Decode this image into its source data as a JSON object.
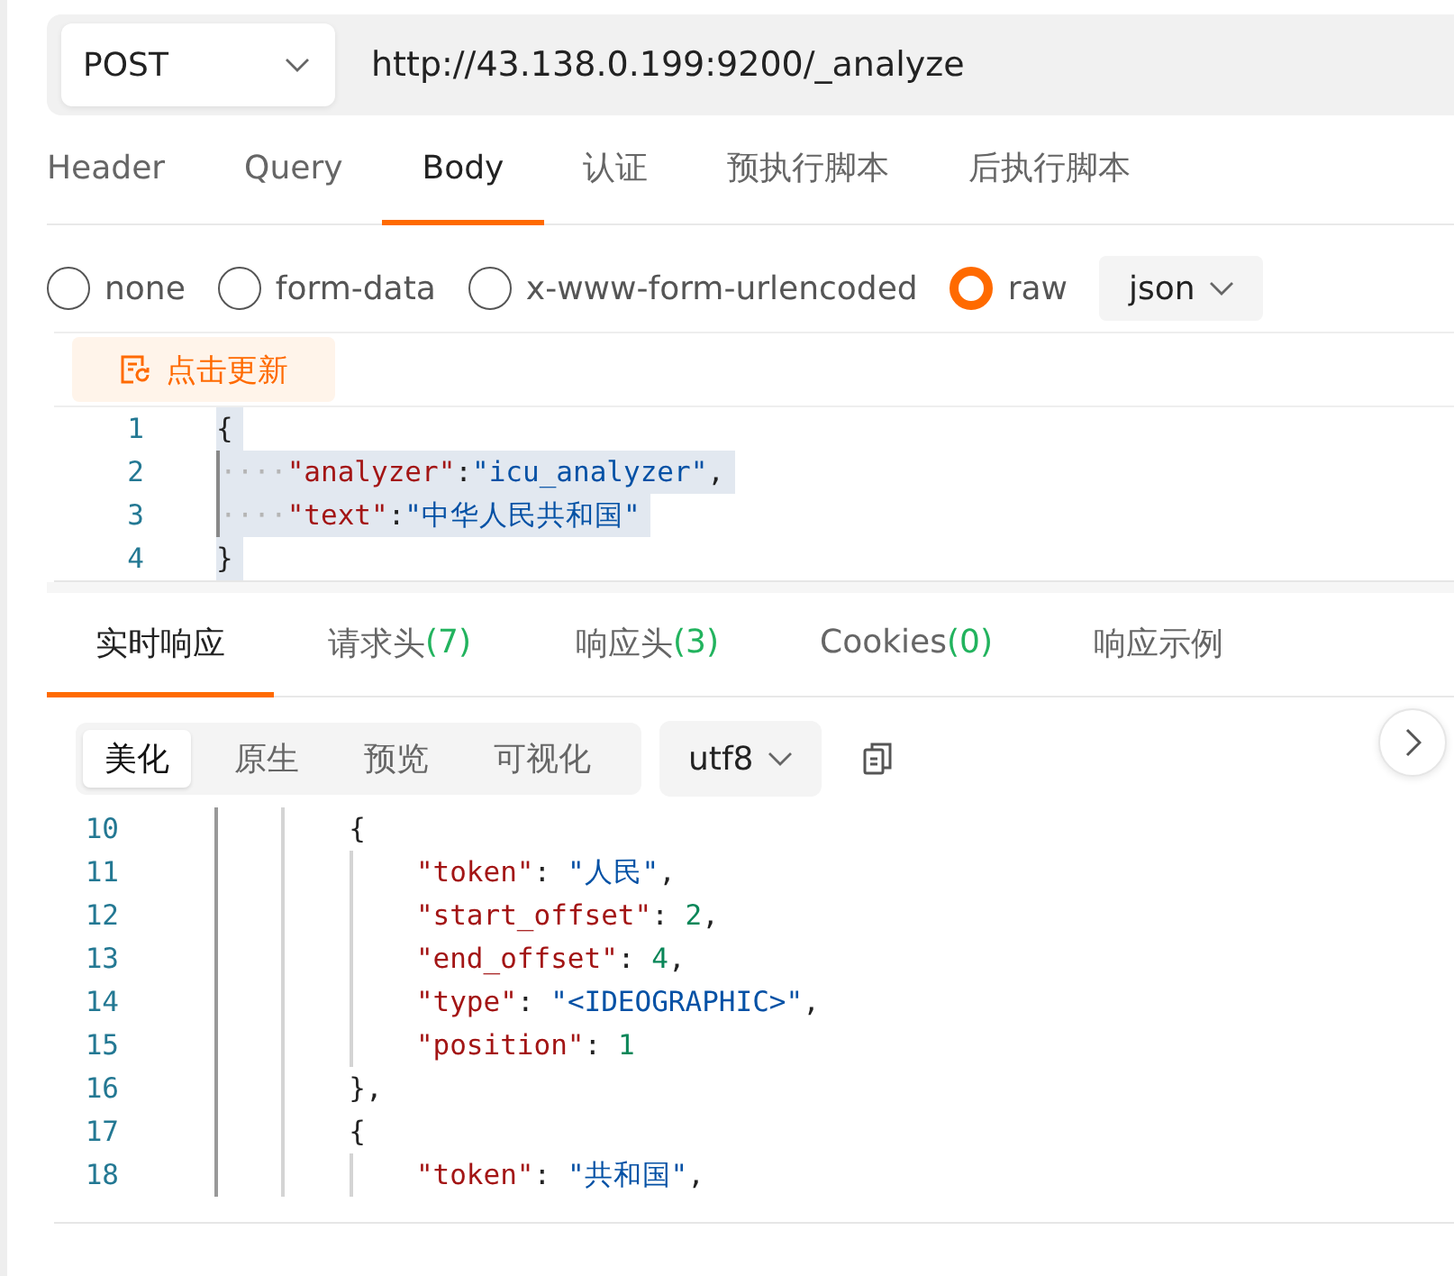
{
  "request": {
    "method": "POST",
    "url": "http://43.138.0.199:9200/_analyze"
  },
  "request_tabs": [
    {
      "label": "Header",
      "selected": false
    },
    {
      "label": "Query",
      "selected": false
    },
    {
      "label": "Body",
      "selected": true
    },
    {
      "label": "认证",
      "selected": false
    },
    {
      "label": "预执行脚本",
      "selected": false
    },
    {
      "label": "后执行脚本",
      "selected": false
    }
  ],
  "body_types": [
    {
      "label": "none",
      "selected": false
    },
    {
      "label": "form-data",
      "selected": false
    },
    {
      "label": "x-www-form-urlencoded",
      "selected": false
    },
    {
      "label": "raw",
      "selected": true
    }
  ],
  "format_select": "json",
  "update_button": "点击更新",
  "request_body": {
    "lines": [
      {
        "number": "1",
        "tokens": [
          {
            "kind": "punct",
            "text": "{"
          }
        ]
      },
      {
        "number": "2",
        "tokens": [
          {
            "kind": "ws",
            "text": "····"
          },
          {
            "kind": "key",
            "text": "\"analyzer\""
          },
          {
            "kind": "punct",
            "text": ":"
          },
          {
            "kind": "str",
            "text": "\"icu_analyzer\""
          },
          {
            "kind": "punct",
            "text": ","
          }
        ]
      },
      {
        "number": "3",
        "tokens": [
          {
            "kind": "ws",
            "text": "····"
          },
          {
            "kind": "key",
            "text": "\"text\""
          },
          {
            "kind": "punct",
            "text": ":"
          },
          {
            "kind": "str",
            "text": "\"中华人民共和国\""
          }
        ]
      },
      {
        "number": "4",
        "tokens": [
          {
            "kind": "punct",
            "text": "}"
          }
        ]
      }
    ]
  },
  "response_tabs": [
    {
      "label": "实时响应",
      "selected": true
    },
    {
      "label": "请求头",
      "count": "(7)",
      "selected": false
    },
    {
      "label": "响应头",
      "count": "(3)",
      "selected": false
    },
    {
      "label": "Cookies",
      "count": "(0)",
      "selected": false
    },
    {
      "label": "响应示例",
      "selected": false
    }
  ],
  "view_modes": [
    {
      "label": "美化",
      "selected": true
    },
    {
      "label": "原生",
      "selected": false
    },
    {
      "label": "预览",
      "selected": false
    },
    {
      "label": "可视化",
      "selected": false
    }
  ],
  "encoding_select": "utf8",
  "response_body": {
    "lines": [
      {
        "number": "10",
        "guides": [
          {
            "kind": "outer"
          },
          {
            "kind": "inner"
          }
        ],
        "tokens": [
          {
            "kind": "punct",
            "text": "{"
          }
        ]
      },
      {
        "number": "11",
        "guides": [
          {
            "kind": "outer"
          },
          {
            "kind": "inner"
          },
          {
            "kind": "inner"
          }
        ],
        "tokens": [
          {
            "kind": "key",
            "text": "\"token\""
          },
          {
            "kind": "punct",
            "text": ": "
          },
          {
            "kind": "str",
            "text": "\"人民\""
          },
          {
            "kind": "punct",
            "text": ","
          }
        ]
      },
      {
        "number": "12",
        "guides": [
          {
            "kind": "outer"
          },
          {
            "kind": "inner"
          },
          {
            "kind": "inner"
          }
        ],
        "tokens": [
          {
            "kind": "key",
            "text": "\"start_offset\""
          },
          {
            "kind": "punct",
            "text": ": "
          },
          {
            "kind": "num",
            "text": "2"
          },
          {
            "kind": "punct",
            "text": ","
          }
        ]
      },
      {
        "number": "13",
        "guides": [
          {
            "kind": "outer"
          },
          {
            "kind": "inner"
          },
          {
            "kind": "inner"
          }
        ],
        "tokens": [
          {
            "kind": "key",
            "text": "\"end_offset\""
          },
          {
            "kind": "punct",
            "text": ": "
          },
          {
            "kind": "num",
            "text": "4"
          },
          {
            "kind": "punct",
            "text": ","
          }
        ]
      },
      {
        "number": "14",
        "guides": [
          {
            "kind": "outer"
          },
          {
            "kind": "inner"
          },
          {
            "kind": "inner"
          }
        ],
        "tokens": [
          {
            "kind": "key",
            "text": "\"type\""
          },
          {
            "kind": "punct",
            "text": ": "
          },
          {
            "kind": "str",
            "text": "\"<IDEOGRAPHIC>\""
          },
          {
            "kind": "punct",
            "text": ","
          }
        ]
      },
      {
        "number": "15",
        "guides": [
          {
            "kind": "outer"
          },
          {
            "kind": "inner"
          },
          {
            "kind": "inner"
          }
        ],
        "tokens": [
          {
            "kind": "key",
            "text": "\"position\""
          },
          {
            "kind": "punct",
            "text": ": "
          },
          {
            "kind": "num",
            "text": "1"
          }
        ]
      },
      {
        "number": "16",
        "guides": [
          {
            "kind": "outer"
          },
          {
            "kind": "inner"
          }
        ],
        "tokens": [
          {
            "kind": "punct",
            "text": "},"
          }
        ]
      },
      {
        "number": "17",
        "guides": [
          {
            "kind": "outer"
          },
          {
            "kind": "inner"
          }
        ],
        "tokens": [
          {
            "kind": "punct",
            "text": "{"
          }
        ]
      },
      {
        "number": "18",
        "guides": [
          {
            "kind": "outer"
          },
          {
            "kind": "inner"
          },
          {
            "kind": "inner"
          }
        ],
        "tokens": [
          {
            "kind": "key",
            "text": "\"token\""
          },
          {
            "kind": "punct",
            "text": ": "
          },
          {
            "kind": "str",
            "text": "\"共和国\""
          },
          {
            "kind": "punct",
            "text": ","
          }
        ]
      }
    ]
  }
}
